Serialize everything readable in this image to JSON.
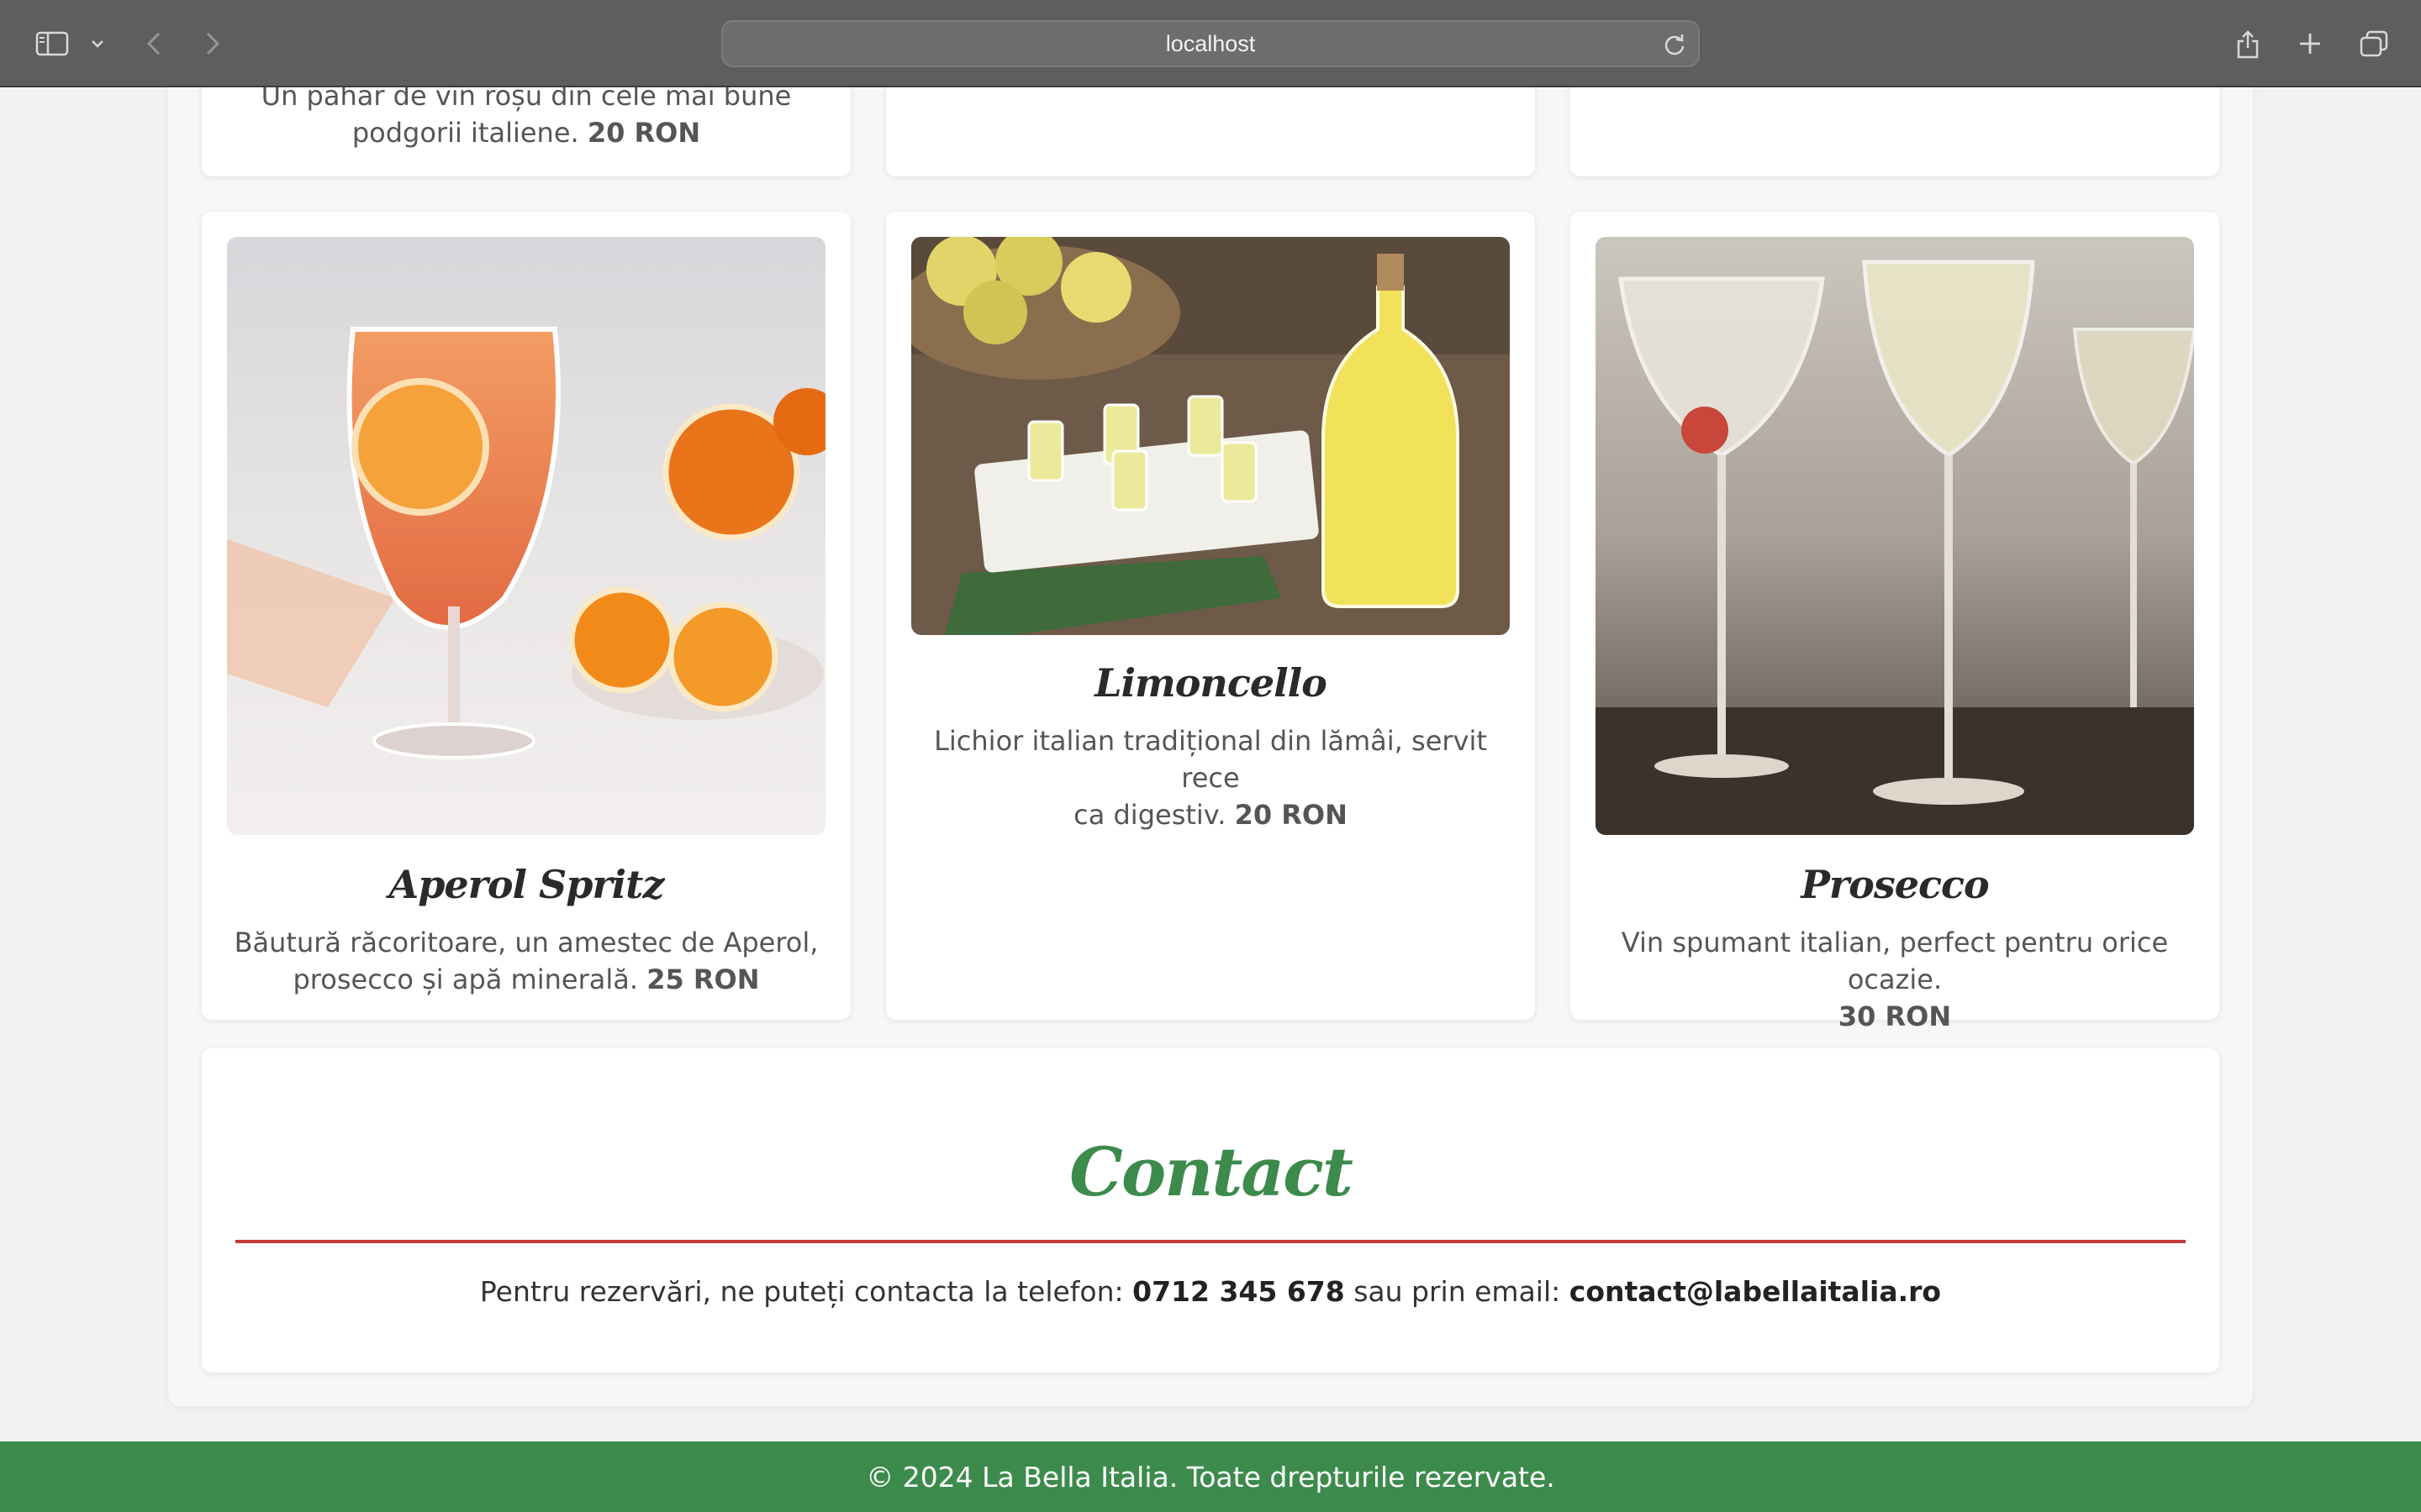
{
  "browser": {
    "address": "localhost"
  },
  "menu": {
    "top_row": {
      "partial_desc_line1": "Un pahar de vin roșu din cele mai bune",
      "partial_desc_line2": "podgorii italiene.",
      "partial_price": "20 RON"
    },
    "items": [
      {
        "title": "Aperol Spritz",
        "desc_line1": "Băutură răcoritoare, un amestec de Aperol,",
        "desc_line2": "prosecco și apă minerală.",
        "price": "25 RON",
        "image": "aperol-spritz-photo"
      },
      {
        "title": "Limoncello",
        "desc_line1": "Lichior italian tradițional din lămâi, servit rece",
        "desc_line2": "ca digestiv.",
        "price": "20 RON",
        "image": "limoncello-photo"
      },
      {
        "title": "Prosecco",
        "desc_line1": "Vin spumant italian, perfect pentru orice ocazie.",
        "desc_line2": "",
        "price": "30 RON",
        "image": "prosecco-photo"
      }
    ]
  },
  "contact": {
    "title": "Contact",
    "text_before_phone": "Pentru rezervări, ne puteți contacta la telefon:",
    "phone": "0712 345 678",
    "text_before_email": "sau prin email:",
    "email": "contact@labellaitalia.ro"
  },
  "footer": {
    "text": "© 2024 La Bella Italia. Toate drepturile rezervate."
  },
  "colors": {
    "accent_green": "#3d8b4c",
    "divider_red": "#c33b3b"
  }
}
